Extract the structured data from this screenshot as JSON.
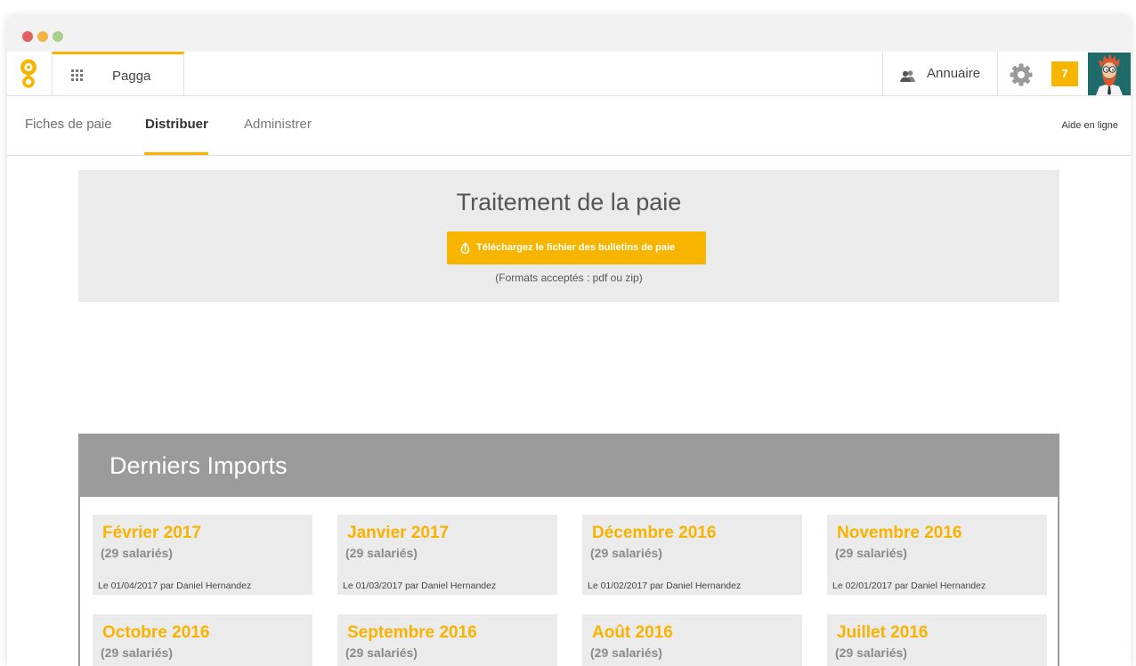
{
  "colors": {
    "accent": "#f8b500",
    "panel_bg": "#ebebeb",
    "imports_header_bg": "#9b9b9b",
    "card_title": "#f8b300",
    "avatar_bg": "#1e6b6a"
  },
  "window": {
    "controls": [
      "#e2605d",
      "#f2b443",
      "#a9d18e"
    ]
  },
  "topbar": {
    "logo_icon": "logo-icon",
    "app_tab": {
      "icon": "grid-icon",
      "label": "Pagga"
    },
    "directory": {
      "icon": "people-icon",
      "label": "Annuaire"
    },
    "settings_icon": "gear-icon",
    "notifications_count": "7",
    "avatar_icon": "user-avatar"
  },
  "subnav": {
    "tabs": [
      {
        "label": "Fiches de paie",
        "active": false
      },
      {
        "label": "Distribuer",
        "active": true
      },
      {
        "label": "Administrer",
        "active": false
      }
    ],
    "help_link": "Aide en ligne"
  },
  "upload_panel": {
    "title": "Traitement de la paie",
    "button": {
      "icon": "upload-icon",
      "label": "Téléchargez le fichier des bulletins de paie"
    },
    "formats_note": "(Formats acceptés : pdf ou zip)"
  },
  "imports": {
    "title": "Derniers Imports",
    "cards": [
      {
        "period": "Février 2017",
        "employees": "(29 salariés)",
        "meta": "Le 01/04/2017 par Daniel Hernandez"
      },
      {
        "period": "Janvier 2017",
        "employees": "(29 salariés)",
        "meta": "Le 01/03/2017 par Daniel Hernandez"
      },
      {
        "period": "Décembre 2016",
        "employees": "(29 salariés)",
        "meta": "Le 01/02/2017 par Daniel Hernandez"
      },
      {
        "period": "Novembre 2016",
        "employees": "(29 salariés)",
        "meta": "Le 02/01/2017 par Daniel Hernandez"
      },
      {
        "period": "Octobre 2016",
        "employees": "(29 salariés)"
      },
      {
        "period": "Septembre 2016",
        "employees": "(29 salariés)"
      },
      {
        "period": "Août 2016",
        "employees": "(29 salariés)"
      },
      {
        "period": "Juillet 2016",
        "employees": "(29 salariés)"
      }
    ]
  }
}
